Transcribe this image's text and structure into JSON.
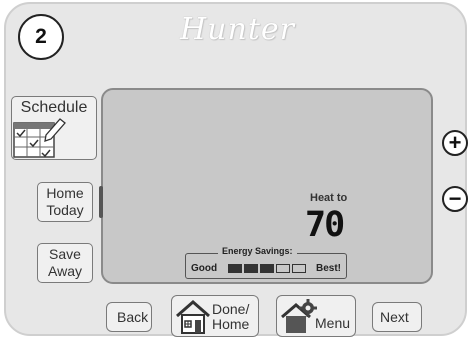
{
  "step_badge": "2",
  "brand": "Hunter",
  "side_buttons": {
    "schedule": "Schedule",
    "home_today": [
      "Home",
      "Today"
    ],
    "save_away": [
      "Save",
      "Away"
    ]
  },
  "display": {
    "heat_label": "Heat to",
    "temperature": "70",
    "energy_savings": {
      "title": "Energy Savings:",
      "good": "Good",
      "best": "Best!",
      "level_fraction": 0.6
    }
  },
  "controls": {
    "plus": "+",
    "minus": "−"
  },
  "nav": {
    "back": "Back",
    "done": [
      "Done/",
      "Home"
    ],
    "menu": "Menu",
    "next": "Next"
  }
}
